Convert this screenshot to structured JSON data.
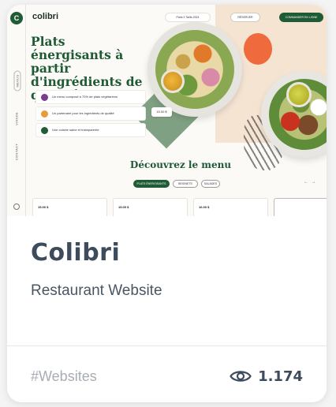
{
  "thumbnail": {
    "brand": "colibri",
    "logo_letter": "C",
    "nav_vertical": [
      "MENUS",
      "VIANDE",
      "CONTACT"
    ],
    "header": {
      "address_label": "Paris 2 Tarifs 2024",
      "reserve_label": "RÉSERVER",
      "order_label": "COMMANDER EN LIGNE"
    },
    "hero_title": "Plats énergisants à partir d'ingrédients de qualité",
    "features": [
      {
        "text": "Un menu composé à 70% de plats végétariens",
        "color": "#7a3f8c"
      },
      {
        "text": "Un partenaire pour les ingrédients de qualité",
        "color": "#e89b3a"
      },
      {
        "text": "Une cuisine saine et transparente",
        "color": "#1f5c36"
      }
    ],
    "price_tag": "15.00 $",
    "menu_title": "Découvrez le menu",
    "tabs": [
      "PLATS ÉNERGISANTS",
      "BEIGNETS",
      "SALADES"
    ],
    "arrows": "← →",
    "products": [
      {
        "price": "15.00 $"
      },
      {
        "price": "15.00 $"
      },
      {
        "price": "16.00 $"
      }
    ]
  },
  "card": {
    "title": "Colibri",
    "subtitle": "Restaurant Website",
    "tag": "#Websites",
    "views": "1.174",
    "view_icon": "eye-icon"
  },
  "colors": {
    "title": "#3d4b5c",
    "tag": "#a8adb4",
    "brand_green": "#1f5c36"
  }
}
